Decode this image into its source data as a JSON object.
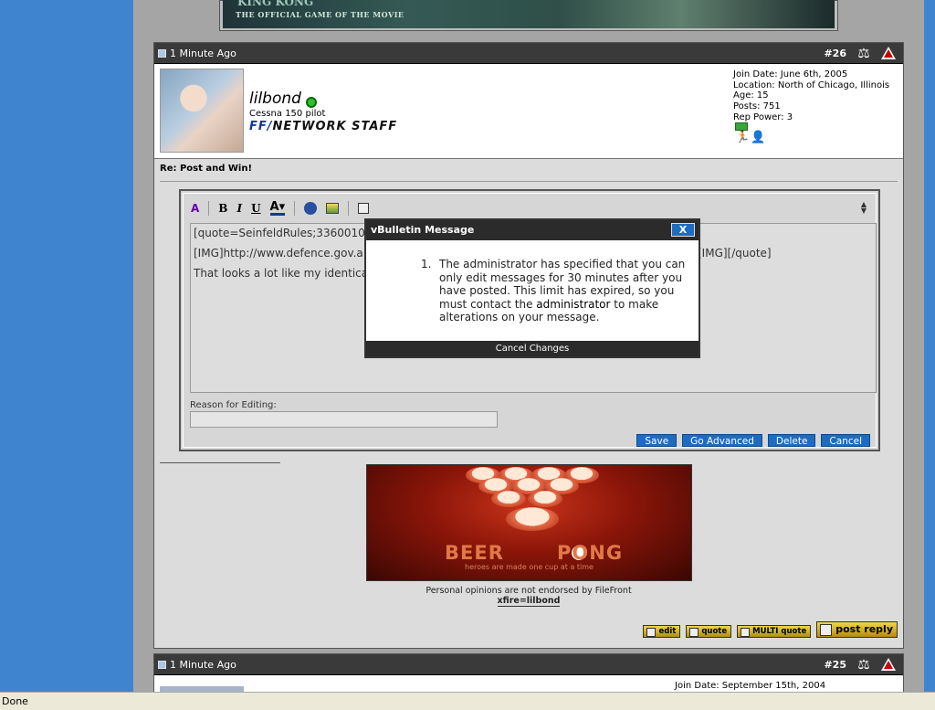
{
  "banner_top": {
    "subtitle": "THE OFFICIAL GAME OF THE MOVIE",
    "title": "KING KONG"
  },
  "post26": {
    "time": "1 Minute Ago",
    "number": "#26",
    "username": "lilbond",
    "user_title": "Cessna 150 pilot",
    "staff_prefix": "FF/",
    "staff_text": "NETWORK STAFF",
    "info": [
      "Join Date: June 6th, 2005",
      "Location: North of Chicago, Illinois",
      "Age: 15",
      "Posts: 751",
      "Rep Power: 3"
    ],
    "post_title": "Re: Post and Win!",
    "editor": {
      "lines": [
        "[quote=SeinfeldRules;3360010]",
        "[IMG]http://www.defence.gov.a",
        "[IMG][/quote]",
        "That looks a lot like my identica"
      ],
      "reason_label": "Reason for Editing:",
      "reason_value": "",
      "buttons": {
        "save": "Save",
        "advanced": "Go Advanced",
        "delete": "Delete",
        "cancel": "Cancel"
      }
    },
    "signature": {
      "beer": "BEER",
      "pong": "PONG",
      "tagline": "heroes are made one cup at a time",
      "disclaimer": "Personal opinions are not endorsed by FileFront",
      "xfire": "xfire=lilbond"
    },
    "post_buttons": {
      "edit": "edit",
      "quote": "quote",
      "multiquote": "MULTI quote",
      "reply": "post reply"
    }
  },
  "post25": {
    "time": "1 Minute Ago",
    "number": "#25",
    "join": "Join Date: September 15th, 2004"
  },
  "dialog": {
    "title": "vBulletin Message",
    "close": "X",
    "number": "1.",
    "message_pre": "The administrator has specified that you can only edit messages for 30 minutes after you have posted. This limit has expired, so you must contact the ",
    "message_link": "administrator",
    "message_post": " to make alterations on your message.",
    "footer": "Cancel Changes"
  },
  "status_bar": {
    "text": "Done"
  }
}
